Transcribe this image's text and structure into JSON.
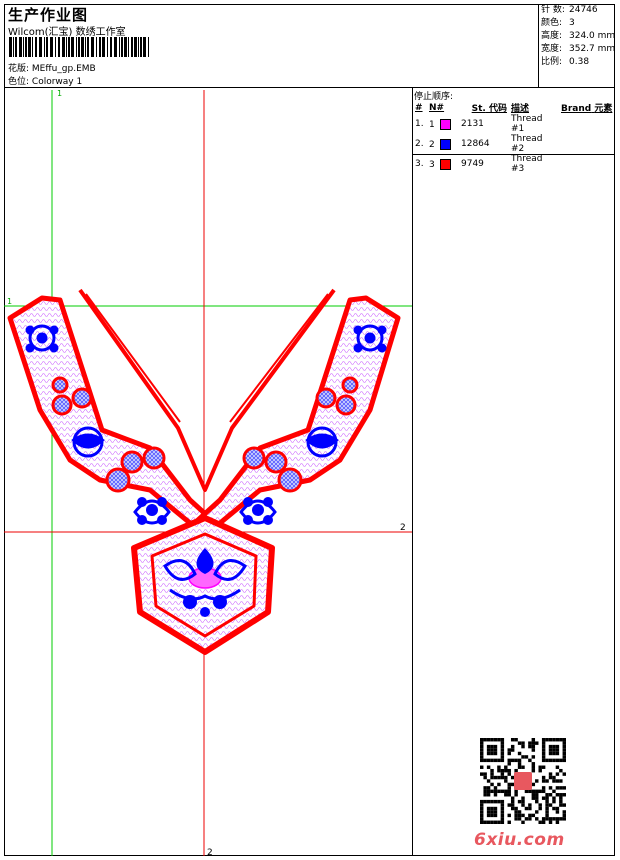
{
  "header": {
    "title": "生产作业图",
    "subtitle": "Wilcom(汇宝) 数绣工作室",
    "design_label": "花版:",
    "design_value": "MEffu_gp.EMB",
    "colorway_label": "色位:",
    "colorway_value": "Colorway 1"
  },
  "stats": [
    {
      "key": "针 数:",
      "value": "24746"
    },
    {
      "key": "颜色:",
      "value": "3"
    },
    {
      "key": "高度:",
      "value": "324.0 mm"
    },
    {
      "key": "宽度:",
      "value": "352.7 mm"
    },
    {
      "key": "比例:",
      "value": "0.38"
    }
  ],
  "sequence": {
    "title": "停止顺序:",
    "headers": [
      "#",
      "N#",
      "St.",
      "代码",
      "描述",
      "Brand",
      "元素"
    ],
    "rows": [
      {
        "num": "1.",
        "n": "1",
        "color": "#ff00ff",
        "st": "2131",
        "desc": "Thread #1"
      },
      {
        "num": "2.",
        "n": "2",
        "color": "#0000ff",
        "st": "12864",
        "desc": "Thread #2"
      },
      {
        "num": "3.",
        "n": "3",
        "color": "#ff0000",
        "st": "9749",
        "desc": "Thread #3"
      }
    ]
  },
  "guides": {
    "v1_label": "1",
    "h1_label": "1",
    "h2_label": "2",
    "v2_label": "2"
  },
  "watermark": "6xiu.com",
  "colors": {
    "red": "#ff0000",
    "blue": "#0000ff",
    "magenta": "#ff00ff",
    "guide_green": "#00cc00",
    "guide_red": "#ee0000"
  }
}
